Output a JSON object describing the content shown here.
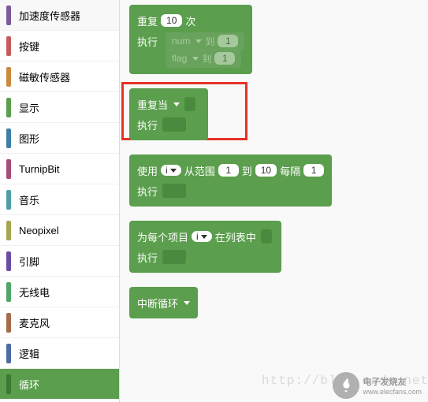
{
  "sidebar": {
    "items": [
      {
        "label": "加速度传感器",
        "color": "#7a5c9e"
      },
      {
        "label": "按键",
        "color": "#c75b5b"
      },
      {
        "label": "磁敏传感器",
        "color": "#c98a3d"
      },
      {
        "label": "显示",
        "color": "#5b9e4d"
      },
      {
        "label": "图形",
        "color": "#3d7fa6"
      },
      {
        "label": "TurnipBit",
        "color": "#a64d7a"
      },
      {
        "label": "音乐",
        "color": "#4d9ea6"
      },
      {
        "label": "Neopixel",
        "color": "#a6a64d"
      },
      {
        "label": "引脚",
        "color": "#6b4da6"
      },
      {
        "label": "无线电",
        "color": "#4da66b"
      },
      {
        "label": "麦克风",
        "color": "#a66b4d"
      },
      {
        "label": "逻辑",
        "color": "#4d6ba6"
      },
      {
        "label": "循环",
        "color": "#5b9e4d"
      }
    ],
    "active_index": 12
  },
  "blocks": {
    "repeat_n": {
      "label1": "重复",
      "value": "10",
      "label2": "次",
      "do": "执行"
    },
    "ghost1": {
      "var": "num",
      "to": "到",
      "val": "1"
    },
    "ghost2": {
      "var": "flag",
      "to": "到",
      "val": "1"
    },
    "repeat_while": {
      "label": "重复当",
      "do": "执行"
    },
    "for_range": {
      "label1": "使用",
      "var": "i",
      "label2": "从范围",
      "from": "1",
      "label3": "到",
      "to": "10",
      "label4": "每隔",
      "step": "1",
      "do": "执行"
    },
    "for_each": {
      "label1": "为每个项目",
      "var": "i",
      "label2": "在列表中",
      "do": "执行"
    },
    "break": {
      "label": "中断循环"
    }
  },
  "watermark": "http://blog.csdn.net/we",
  "footer": {
    "brand": "电子发烧友",
    "url": "www.elecfans.com"
  }
}
